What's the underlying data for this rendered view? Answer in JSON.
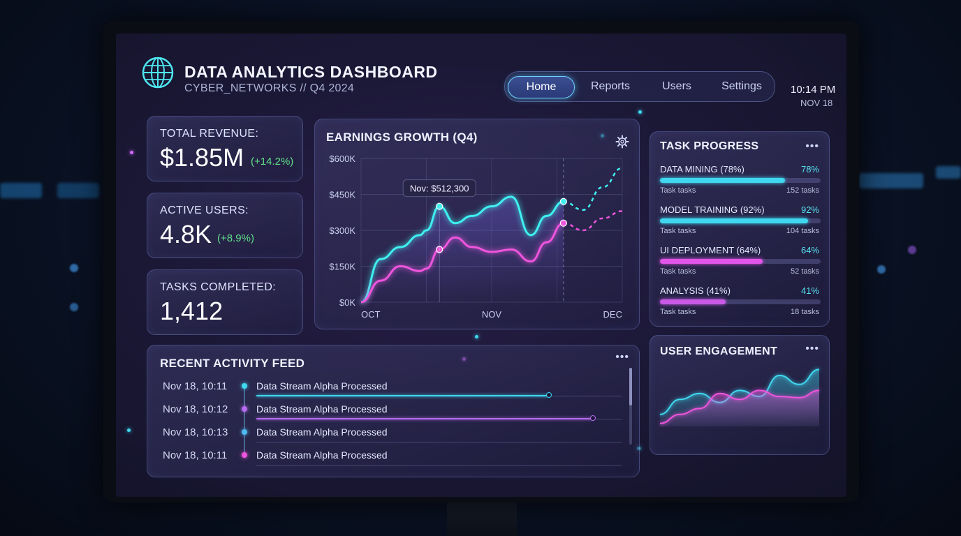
{
  "header": {
    "title": "DATA ANALYTICS DASHBOARD",
    "subtitle": "CYBER_NETWORKS // Q4 2024"
  },
  "nav": {
    "items": [
      {
        "label": "Home",
        "active": true
      },
      {
        "label": "Reports",
        "active": false
      },
      {
        "label": "Users",
        "active": false
      },
      {
        "label": "Settings",
        "active": false
      }
    ]
  },
  "clock": {
    "time": "10:14 PM",
    "date": "NOV 18"
  },
  "stats": [
    {
      "label": "TOTAL REVENUE:",
      "value": "$1.85M",
      "delta": "(+14.2%)"
    },
    {
      "label": "ACTIVE USERS:",
      "value": "4.8K",
      "delta": "(+8.9%)"
    },
    {
      "label": "TASKS COMPLETED:",
      "value": "1,412",
      "delta": ""
    }
  ],
  "earnings": {
    "title": "EARNINGS GROWTH (Q4)",
    "tooltip": "Nov: $512,300"
  },
  "chart_data": {
    "type": "line",
    "title": "EARNINGS GROWTH (Q4)",
    "x_tick_labels": [
      "OCT",
      "NOV",
      "DEC"
    ],
    "y_tick_labels": [
      "$600K",
      "$450K",
      "$300K",
      "$150K",
      "$0K"
    ],
    "ylim": [
      0,
      600000
    ],
    "x": [
      0,
      0.15,
      0.3,
      0.45,
      0.5,
      0.6,
      0.72,
      0.85,
      1.0,
      1.15,
      1.3,
      1.42,
      1.55,
      1.7,
      1.85,
      2.0
    ],
    "series": [
      {
        "color": "#3ff0f0",
        "dashed_from_index": 12,
        "values": [
          0,
          180000,
          230000,
          280000,
          300000,
          400000,
          330000,
          360000,
          400000,
          440000,
          280000,
          360000,
          420000,
          385000,
          480000,
          560000
        ]
      },
      {
        "color": "#ee55dd",
        "dashed_from_index": 12,
        "values": [
          0,
          90000,
          150000,
          130000,
          140000,
          220000,
          270000,
          230000,
          210000,
          220000,
          170000,
          250000,
          330000,
          300000,
          350000,
          380000
        ]
      }
    ],
    "highlight": {
      "x": 0.6,
      "value": 400000,
      "label": "Nov: $512,300"
    },
    "grid": true
  },
  "tasks": {
    "title": "TASK PROGRESS",
    "more": "•••",
    "items": [
      {
        "label": "DATA MINING (78%)",
        "pct_text": "78%",
        "progress": 0.78,
        "sub": "Task tasks",
        "count": "152 tasks",
        "color": "#3fd8f0"
      },
      {
        "label": "MODEL TRAINING (92%)",
        "pct_text": "92%",
        "progress": 0.92,
        "sub": "Task tasks",
        "count": "104 tasks",
        "color": "#3fd8f0"
      },
      {
        "label": "UI DEPLOYMENT (64%)",
        "pct_text": "64%",
        "progress": 0.64,
        "sub": "Task tasks",
        "count": "52 tasks",
        "color": "#e255e8"
      },
      {
        "label": "ANALYSIS (41%)",
        "pct_text": "41%",
        "progress": 0.41,
        "sub": "Task tasks",
        "count": "18 tasks",
        "color": "#c85ae6"
      }
    ]
  },
  "feed": {
    "title": "RECENT ACTIVITY FEED",
    "more": "•••",
    "items": [
      {
        "date": "Nov 18, 10:11",
        "text": "Data Stream Alpha Processed",
        "color": "#3fd8f0",
        "progress": 0.8
      },
      {
        "date": "Nov 18, 10:12",
        "text": "Data Stream Alpha Processed",
        "color": "#b76cf0",
        "progress": 0.92
      },
      {
        "date": "Nov 18, 10:13",
        "text": "Data Stream Alpha Processed",
        "color": "#4fb8ef",
        "progress": 0
      },
      {
        "date": "Nov 18, 10:11",
        "text": "Data Stream Alpha Processed",
        "color": "#ee55dd",
        "progress": 0
      }
    ]
  },
  "engagement": {
    "title": "USER ENGAGEMENT",
    "more": "•••",
    "series": [
      {
        "color": "#3fd8f0",
        "values": [
          0.2,
          0.45,
          0.55,
          0.4,
          0.6,
          0.5,
          0.85,
          0.7,
          0.95
        ]
      },
      {
        "color": "#ee55dd",
        "values": [
          0.05,
          0.2,
          0.3,
          0.55,
          0.45,
          0.6,
          0.5,
          0.48,
          0.6
        ]
      }
    ]
  }
}
